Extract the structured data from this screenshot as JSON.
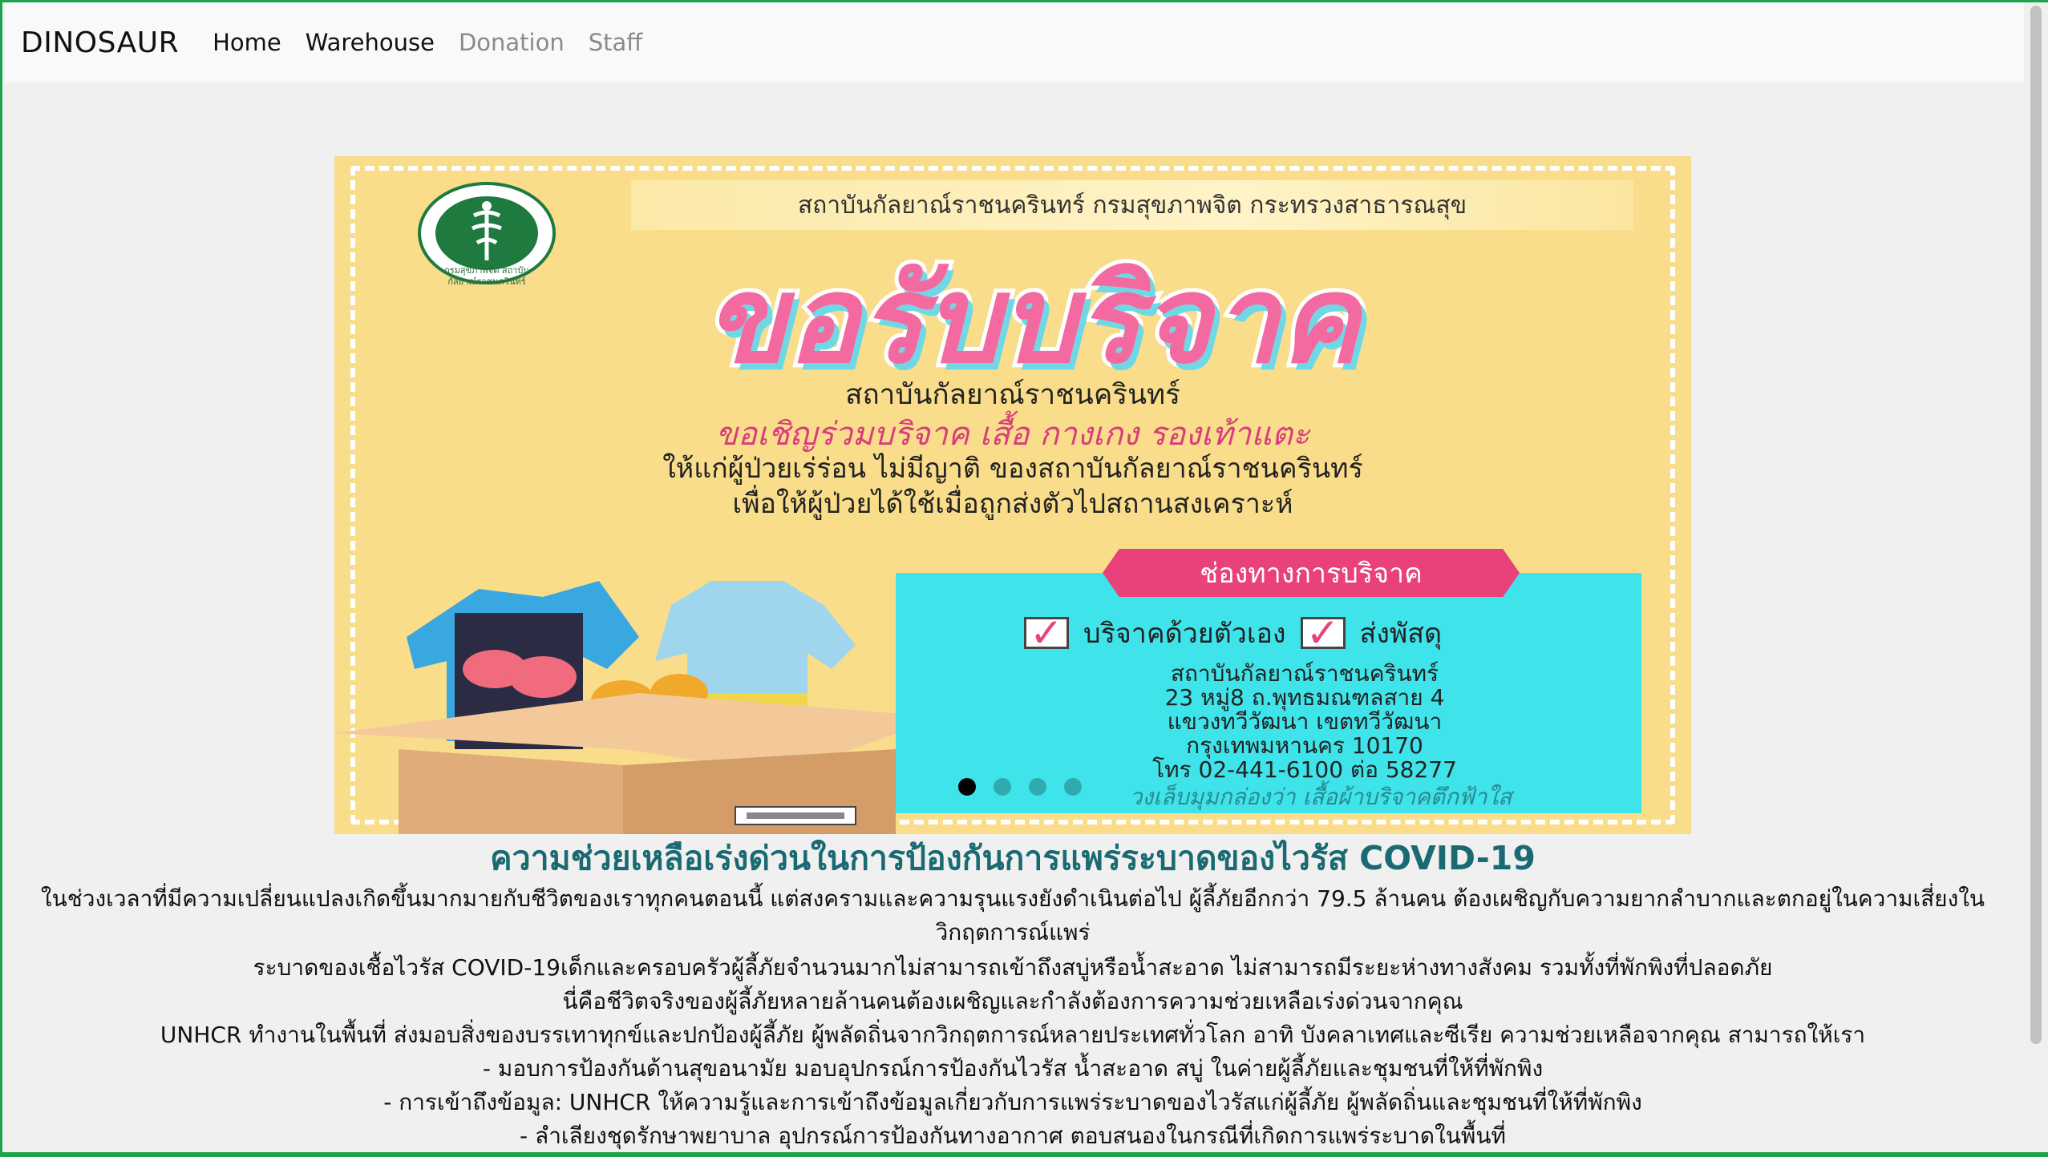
{
  "navbar": {
    "brand": "DINOSAUR",
    "links": [
      {
        "label": "Home",
        "state": "active"
      },
      {
        "label": "Warehouse",
        "state": "active"
      },
      {
        "label": "Donation",
        "state": "muted"
      },
      {
        "label": "Staff",
        "state": "muted"
      }
    ]
  },
  "carousel": {
    "slide": {
      "org_line": "สถาบันกัลยาณ์ราชนครินทร์ กรมสุขภาพจิต กระทรวงสาธารณสุข",
      "seal_caption": "กรมสุขภาพจิต สถาบันกัลยาณ์ราชนครินทร์",
      "headline": "ขอรับบริจาค",
      "sub1": "สถาบันกัลยาณ์ราชนครินทร์",
      "sub2": "ขอเชิญร่วมบริจาค เสื้อ กางเกง รองเท้าแตะ",
      "sub3": "ให้แก่ผู้ป่วยเร่ร่อน ไม่มีญาติ ของสถาบันกัลยาณ์ราชนครินทร์",
      "sub4": "เพื่อให้ผู้ป่วยได้ใช้เมื่อถูกส่งตัวไปสถานสงเคราะห์",
      "ribbon": "ช่องทางการบริจาค",
      "option1": "บริจาคด้วยตัวเอง",
      "option2": "ส่งพัสดุ",
      "address": [
        "สถาบันกัลยาณ์ราชนครินทร์",
        "23 หมู่8 ถ.พุทธมณฑลสาย 4",
        "แขวงทวีวัฒนา เขตทวีวัฒนา",
        "กรุงเทพมหานคร 10170",
        "โทร 02-441-6100 ต่อ 58277"
      ],
      "footer_note": "วงเล็บมุมกล่องว่า เสื้อผ้าบริจาคตึกฟ้าใส"
    },
    "indicator_count": 4,
    "active_index": 0
  },
  "article": {
    "heading": "ความช่วยเหลือเร่งด่วนในการป้องกันการแพร่ระบาดของไวรัส COVID-19",
    "lines": [
      "ในช่วงเวลาที่มีความเปลี่ยนแปลงเกิดขึ้นมากมายกับชีวิตของเราทุกคนตอนนี้ แต่สงครามและความรุนแรงยังดำเนินต่อไป ผู้ลี้ภัยอีกกว่า 79.5 ล้านคน ต้องเผชิญกับความยากลำบากและตกอยู่ในความเสี่ยงในวิกฤตการณ์แพร่",
      "ระบาดของเชื้อไวรัส COVID-19เด็กและครอบครัวผู้ลี้ภัยจำนวนมากไม่สามารถเข้าถึงสบู่หรือน้ำสะอาด ไม่สามารถมีระยะห่างทางสังคม รวมทั้งที่พักพิงที่ปลอดภัย",
      "นี่คือชีวิตจริงของผู้ลี้ภัยหลายล้านคนต้องเผชิญและกำลังต้องการความช่วยเหลือเร่งด่วนจากคุณ",
      "UNHCR ทำงานในพื้นที่ ส่งมอบสิ่งของบรรเทาทุกข์และปกป้องผู้ลี้ภัย ผู้พลัดถิ่นจากวิกฤตการณ์หลายประเทศทั่วโลก อาทิ บังคลาเทศและซีเรีย ความช่วยเหลือจากคุณ สามารถให้เรา",
      "- มอบการป้องกันด้านสุขอนามัย มอบอุปกรณ์การป้องกันไวรัส น้ำสะอาด สบู่ ในค่ายผู้ลี้ภัยและชุมชนที่ให้ที่พักพิง",
      "- การเข้าถึงข้อมูล: UNHCR ให้ความรู้และการเข้าถึงข้อมูลเกี่ยวกับการแพร่ระบาดของไวรัสแก่ผู้ลี้ภัย ผู้พลัดถิ่นและชุมชนที่ให้ที่พักพิง",
      "- ลำเลียงชุดรักษาพยาบาล อุปกรณ์การป้องกันทางอากาศ ตอบสนองในกรณีที่เกิดการแพร่ระบาดในพื้นที่"
    ]
  },
  "colors": {
    "accent_border": "#1fa34a",
    "heading": "#1a6a73",
    "poster_bg": "#f9dd8b",
    "poster_pink": "#e8417b",
    "poster_cyan": "#3fe3ea"
  }
}
